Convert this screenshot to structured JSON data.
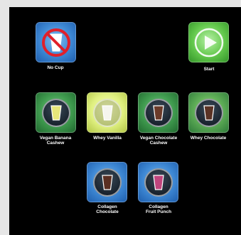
{
  "tiles": {
    "no_cup": {
      "label": "No Cup",
      "icon": "no-cup-icon"
    },
    "start": {
      "label": "Start",
      "icon": "play-icon"
    },
    "vegan_banana_cashew": {
      "label": "Vegan Banana\nCashew",
      "drink_color": "#e7e77a"
    },
    "whey_vanilla": {
      "label": "Whey Vanilla",
      "drink_color": "#f5f5ee"
    },
    "vegan_chocolate_cashew": {
      "label": "Vegan Chocolate\nCashew",
      "drink_color": "#6b3b2a"
    },
    "whey_chocolate": {
      "label": "Whey Chocolate",
      "drink_color": "#5b3325"
    },
    "collagen_chocolate": {
      "label": "Collagen\nChocolate",
      "drink_color": "#5a2f22"
    },
    "collagen_fruit_punch": {
      "label": "Collagen\nFruit Punch",
      "drink_color": "#c0457d"
    }
  }
}
